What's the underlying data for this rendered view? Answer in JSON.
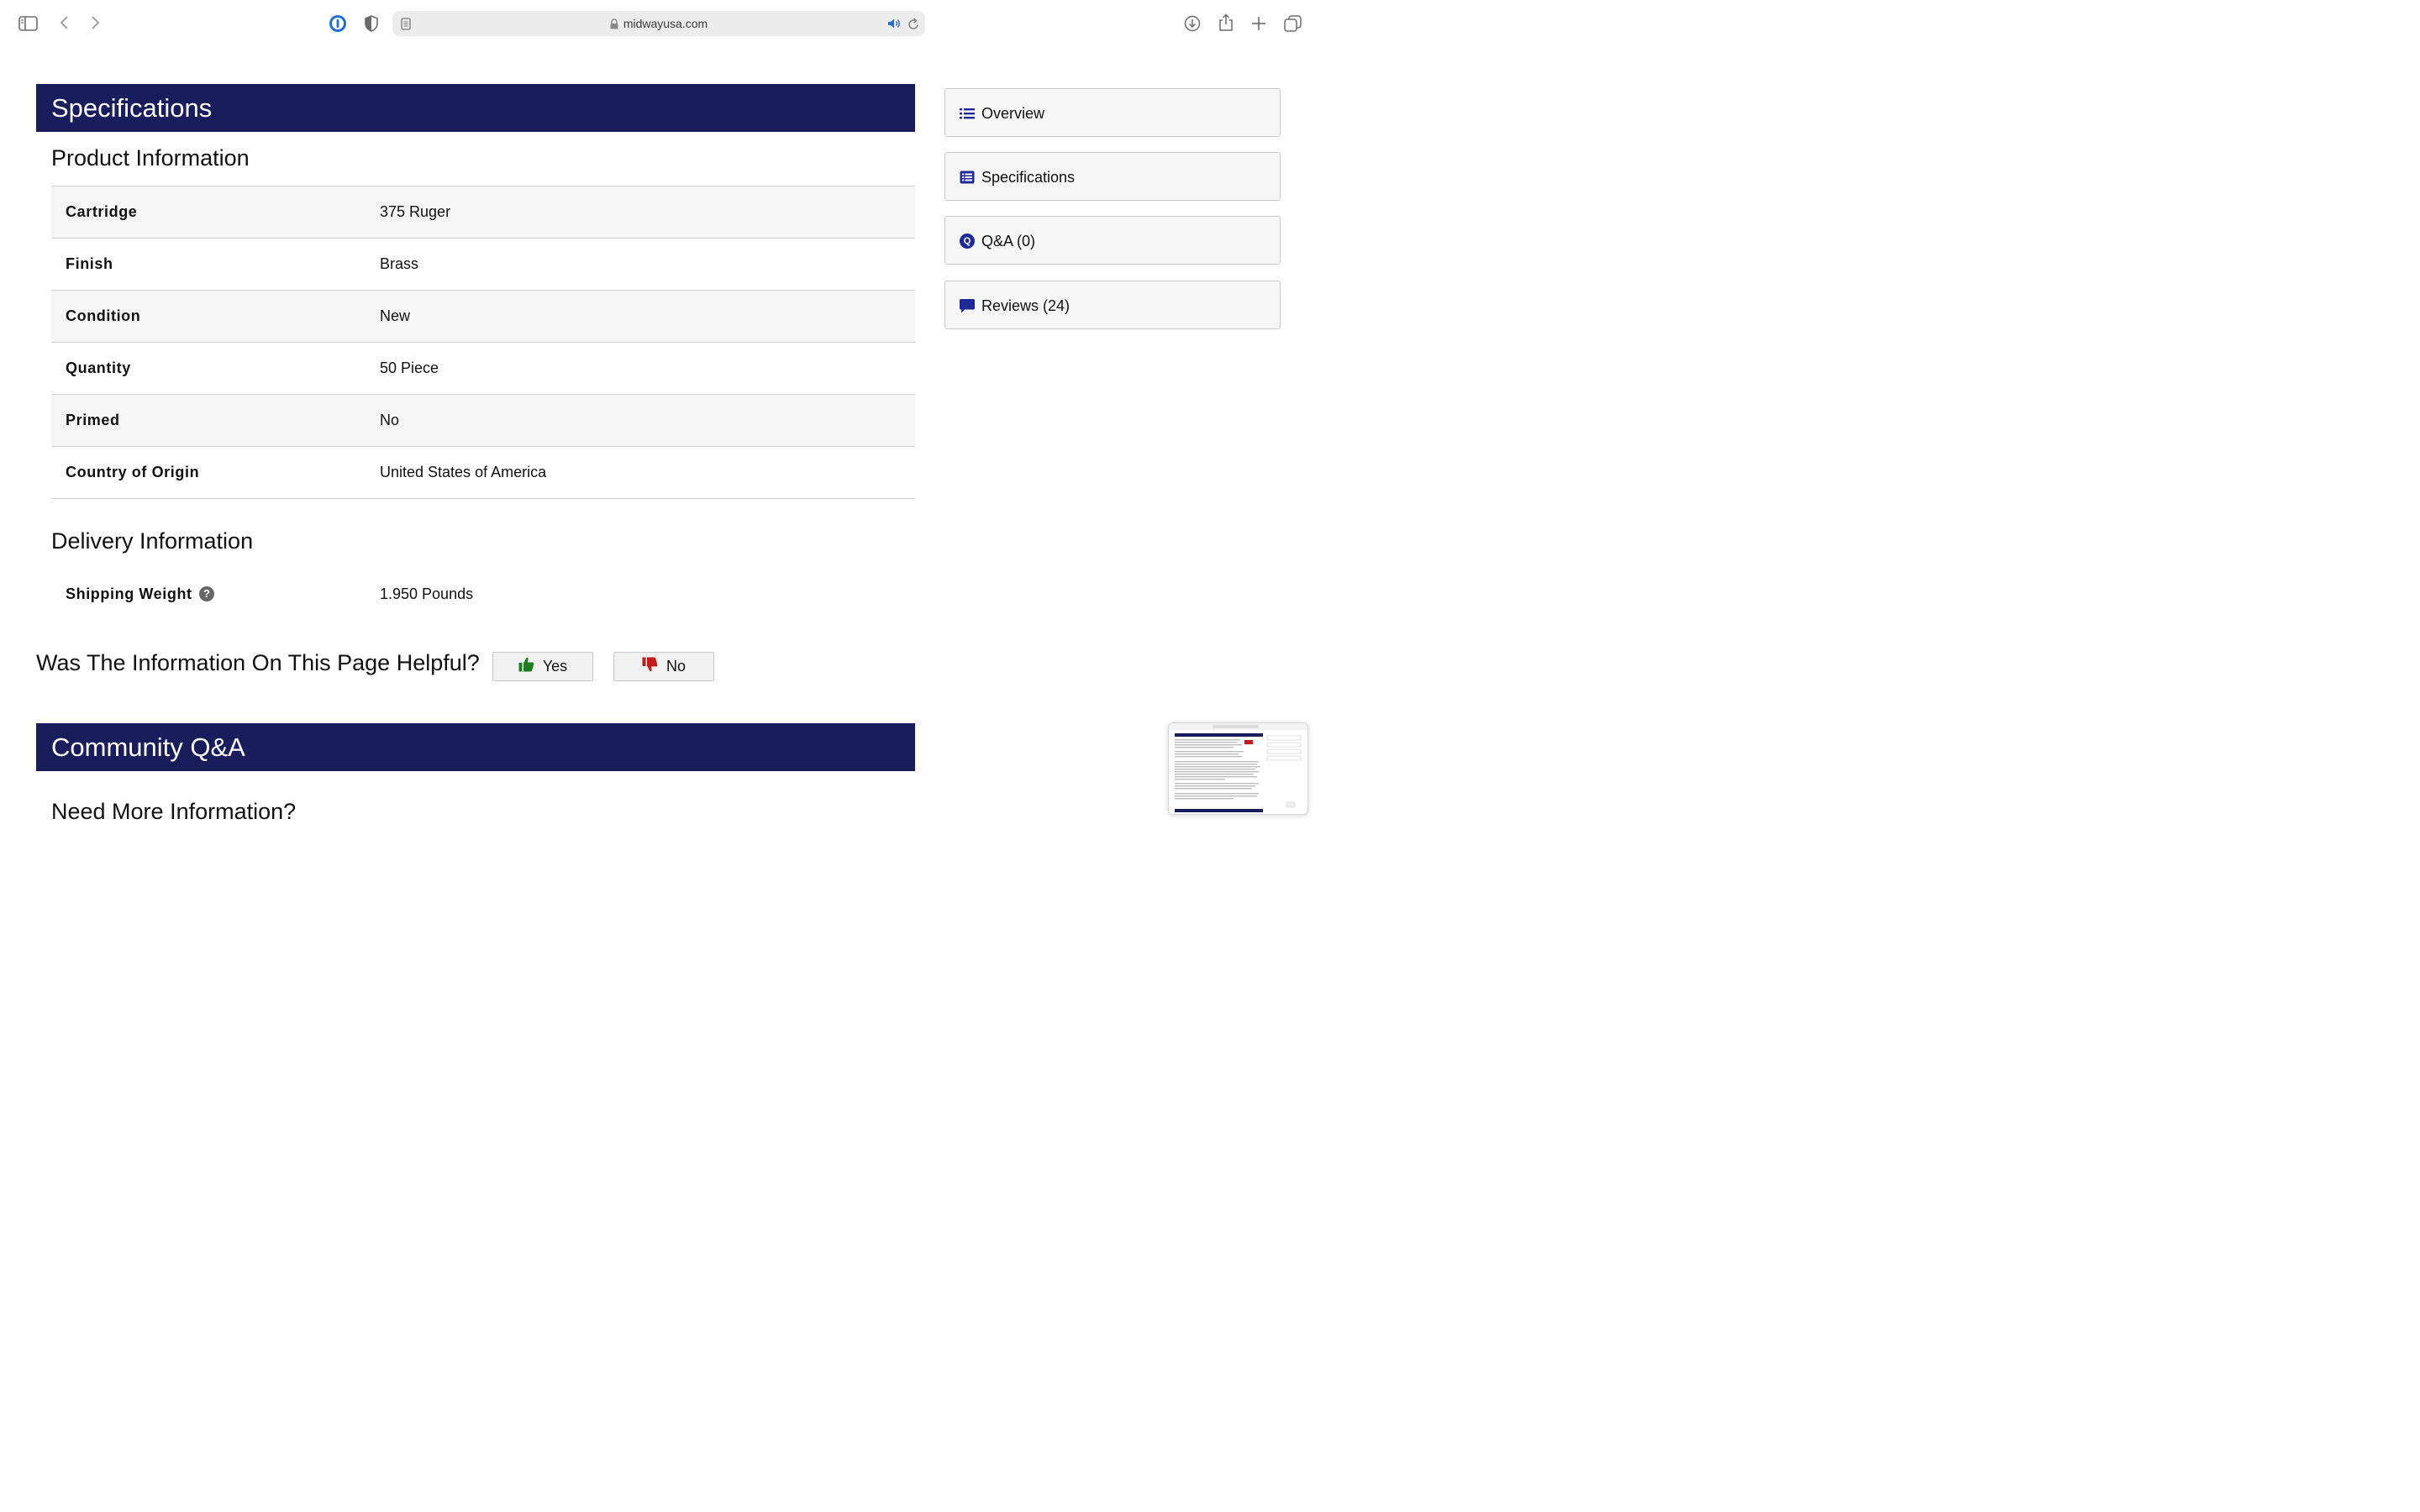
{
  "browser": {
    "url": "midwayusa.com"
  },
  "specifications": {
    "title": "Specifications",
    "product_info_heading": "Product Information",
    "rows": [
      {
        "label": "Cartridge",
        "value": "375 Ruger"
      },
      {
        "label": "Finish",
        "value": "Brass"
      },
      {
        "label": "Condition",
        "value": "New"
      },
      {
        "label": "Quantity",
        "value": "50 Piece"
      },
      {
        "label": "Primed",
        "value": "No"
      },
      {
        "label": "Country of Origin",
        "value": "United States of America"
      }
    ],
    "delivery_heading": "Delivery Information",
    "shipping": {
      "label": "Shipping Weight",
      "value": "1.950 Pounds",
      "help_glyph": "?"
    }
  },
  "feedback": {
    "question": "Was The Information On This Page Helpful?",
    "yes_label": "Yes",
    "no_label": "No"
  },
  "community": {
    "title": "Community Q&A",
    "subheading": "Need More Information?"
  },
  "side_nav": [
    {
      "label": "Overview",
      "icon": "list-icon"
    },
    {
      "label": "Specifications",
      "icon": "table-list-icon"
    },
    {
      "label": "Q&A (0)",
      "icon": "q-circle-icon",
      "glyph": "Q"
    },
    {
      "label": "Reviews (24)",
      "icon": "comment-icon"
    }
  ],
  "colors": {
    "section_bar": "#1a1d5c",
    "icon_blue": "#1f2a9a",
    "thumbs_up": "#1e7d1e",
    "thumbs_down": "#c21a1a"
  }
}
